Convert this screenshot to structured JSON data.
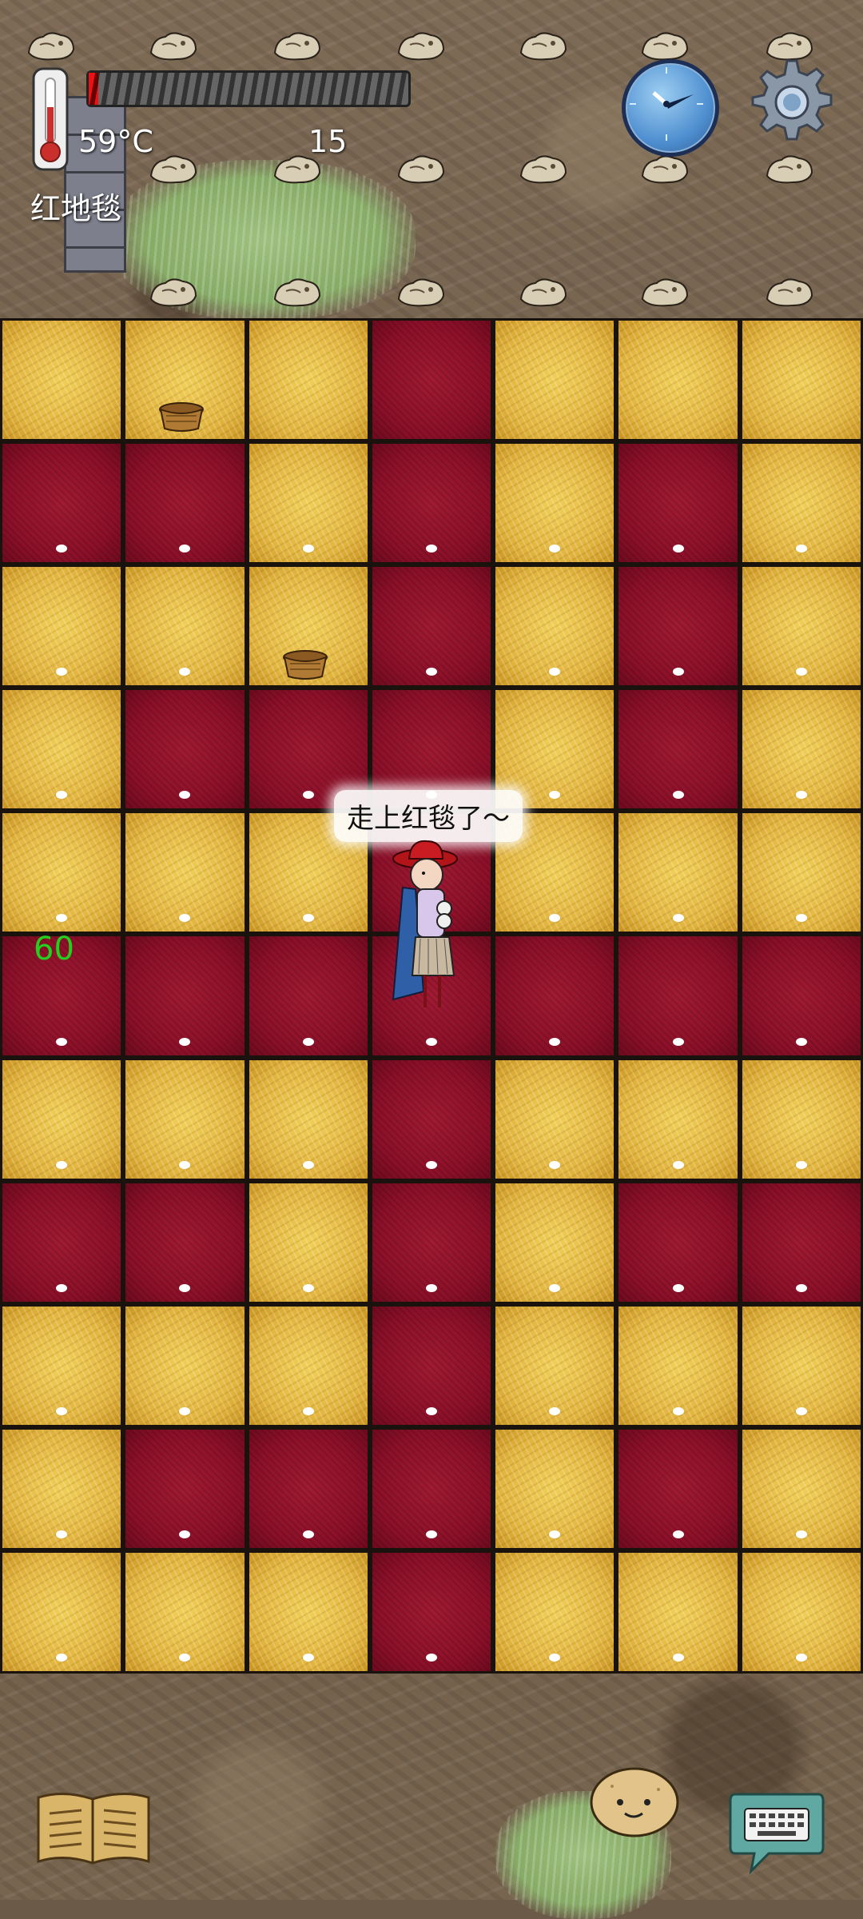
{
  "hud": {
    "temperature": "59°C",
    "count": "15",
    "location": "红地毯",
    "progress_fraction": 0.03
  },
  "icons": {
    "thermometer": "thermometer-icon",
    "compass": "compass-icon",
    "settings": "gear-icon",
    "book": "book-icon",
    "potato": "potato-face-icon",
    "keyboard": "keyboard-chat-icon"
  },
  "speech": "走上红毯了～",
  "floating_number": "60",
  "board": {
    "rows": [
      [
        "y",
        "y",
        "y",
        "r",
        "y",
        "y",
        "y"
      ],
      [
        "r",
        "r",
        "y",
        "r",
        "y",
        "r",
        "y"
      ],
      [
        "y",
        "y",
        "y",
        "r",
        "y",
        "r",
        "y"
      ],
      [
        "y",
        "r",
        "r",
        "r",
        "y",
        "r",
        "y"
      ],
      [
        "y",
        "y",
        "y",
        "r",
        "y",
        "y",
        "y"
      ],
      [
        "r",
        "r",
        "r",
        "r",
        "r",
        "r",
        "r"
      ],
      [
        "y",
        "y",
        "y",
        "r",
        "y",
        "y",
        "y"
      ],
      [
        "r",
        "r",
        "y",
        "r",
        "y",
        "r",
        "r"
      ],
      [
        "y",
        "y",
        "y",
        "r",
        "y",
        "y",
        "y"
      ],
      [
        "y",
        "r",
        "r",
        "r",
        "y",
        "r",
        "y"
      ],
      [
        "y",
        "y",
        "y",
        "r",
        "y",
        "y",
        "y"
      ]
    ]
  },
  "colors": {
    "yellow_tile": "#e1b43e",
    "red_tile": "#8c1029",
    "number_green": "#21d11e"
  }
}
